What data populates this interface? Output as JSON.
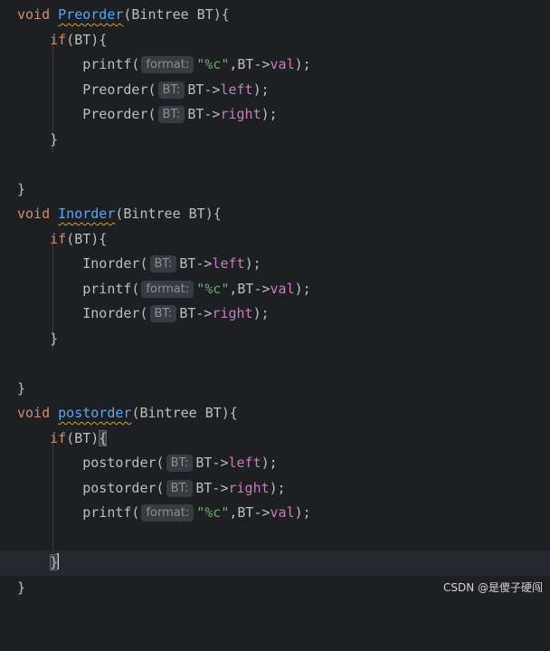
{
  "code": {
    "preorder": {
      "signature_keyword": "void",
      "name": "Preorder",
      "params": "(Bintree BT){",
      "if_keyword": "if",
      "if_cond": "(BT){",
      "printf_call": "printf(",
      "printf_hint": "format:",
      "printf_fmt": "\"%c\"",
      "printf_arg": ",BT->",
      "printf_field": "val",
      "printf_end": ");",
      "call1_name": "Preorder(",
      "call1_hint": "BT:",
      "call1_arg": "BT->",
      "call1_field": "left",
      "call1_end": ");",
      "call2_name": "Preorder(",
      "call2_hint": "BT:",
      "call2_arg": "BT->",
      "call2_field": "right",
      "call2_end": ");",
      "if_close": "}",
      "fn_close": "}"
    },
    "inorder": {
      "signature_keyword": "void",
      "name": "Inorder",
      "params": "(Bintree BT){",
      "if_keyword": "if",
      "if_cond": "(BT){",
      "call1_name": "Inorder(",
      "call1_hint": "BT:",
      "call1_arg": "BT->",
      "call1_field": "left",
      "call1_end": ");",
      "printf_call": "printf(",
      "printf_hint": "format:",
      "printf_fmt": "\"%c\"",
      "printf_arg": ",BT->",
      "printf_field": "val",
      "printf_end": ");",
      "call2_name": "Inorder(",
      "call2_hint": "BT:",
      "call2_arg": "BT->",
      "call2_field": "right",
      "call2_end": ");",
      "if_close": "}",
      "fn_close": "}"
    },
    "postorder": {
      "signature_keyword": "void",
      "name": "postorder",
      "params": "(Bintree BT){",
      "if_keyword": "if",
      "if_cond": "(BT)",
      "if_brace": "{",
      "call1_name": "postorder(",
      "call1_hint": "BT:",
      "call1_arg": "BT->",
      "call1_field": "left",
      "call1_end": ");",
      "call2_name": "postorder(",
      "call2_hint": "BT:",
      "call2_arg": "BT->",
      "call2_field": "right",
      "call2_end": ");",
      "printf_call": "printf(",
      "printf_hint": "format:",
      "printf_fmt": "\"%c\"",
      "printf_arg": ",BT->",
      "printf_field": "val",
      "printf_end": ");",
      "if_close": "}",
      "fn_close": "}"
    }
  },
  "watermark": "CSDN @是傻子硬闯",
  "colors": {
    "background": "#1e1f22",
    "current_line": "#26282e",
    "keyword": "#cf8e6d",
    "function_decl": "#56a8f5",
    "field": "#c77dbb",
    "string": "#6aab73",
    "hint_bg": "#393b40"
  }
}
